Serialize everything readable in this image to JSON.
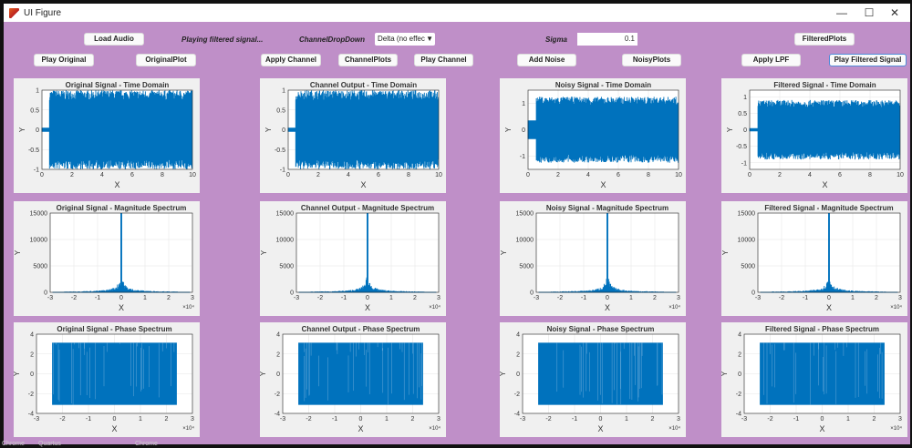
{
  "window": {
    "title": "UI Figure",
    "minimize": "—",
    "maximize": "☐",
    "close": "✕"
  },
  "controls": {
    "load_audio": "Load Audio",
    "status": "Playing filtered signal...",
    "channel_label": "ChannelDropDown",
    "channel_value": "Delta (no effec",
    "sigma_label": "Sigma",
    "sigma_value": "0.1",
    "filtered_plots": "FilteredPlots",
    "play_original": "Play Original",
    "original_plot": "OriginalPlot",
    "apply_channel": "Apply Channel",
    "channel_plots": "ChannelPlots",
    "play_channel": "Play Channel",
    "add_noise": "Add Noise",
    "noisy_plots": "NoisyPlots",
    "apply_lpf": "Apply LPF",
    "play_filtered": "Play Filtered Signal"
  },
  "taskbar": [
    "Chrome",
    "Quartus",
    "Chrome"
  ],
  "colors": {
    "background": "#bf8fc8",
    "trace": "#0072bd"
  },
  "chart_data": [
    {
      "id": "orig-time",
      "type": "line",
      "title": "Original Signal - Time Domain",
      "xlabel": "X",
      "ylabel": "Y",
      "xlim": [
        0,
        10
      ],
      "ylim": [
        -1,
        1
      ],
      "xticks": [
        "0",
        "2",
        "4",
        "6",
        "8",
        "10"
      ],
      "yticks": [
        "-1",
        "-0.5",
        "0",
        "0.5",
        "1"
      ],
      "kind": "time",
      "onset": 0.5,
      "amp": 1,
      "pre": 0.05
    },
    {
      "id": "chan-time",
      "type": "line",
      "title": "Channel Output - Time Domain",
      "xlabel": "X",
      "ylabel": "Y",
      "xlim": [
        0,
        10
      ],
      "ylim": [
        -1,
        1
      ],
      "xticks": [
        "0",
        "2",
        "4",
        "6",
        "8",
        "10"
      ],
      "yticks": [
        "-1",
        "-0.5",
        "0",
        "0.5",
        "1"
      ],
      "kind": "time",
      "onset": 0.5,
      "amp": 1,
      "pre": 0.05
    },
    {
      "id": "noisy-time",
      "type": "line",
      "title": "Noisy Signal - Time Domain",
      "xlabel": "X",
      "ylabel": "Y",
      "xlim": [
        0,
        10
      ],
      "ylim": [
        -1.5,
        1.5
      ],
      "xticks": [
        "0",
        "2",
        "4",
        "6",
        "8",
        "10"
      ],
      "yticks": [
        "-1",
        "0",
        "1"
      ],
      "kind": "time",
      "onset": 0.55,
      "amp": 1.25,
      "pre": 0.35
    },
    {
      "id": "filt-time",
      "type": "line",
      "title": "Filtered Signal - Time Domain",
      "xlabel": "X",
      "ylabel": "Y",
      "xlim": [
        0,
        10
      ],
      "ylim": [
        -1.2,
        1.2
      ],
      "xticks": [
        "0",
        "2",
        "4",
        "6",
        "8",
        "10"
      ],
      "yticks": [
        "-1",
        "-0.5",
        "0",
        "0.5",
        "1"
      ],
      "kind": "time",
      "onset": 0.55,
      "amp": 0.9,
      "pre": 0.05
    },
    {
      "id": "orig-mag",
      "type": "line",
      "title": "Original Signal - Magnitude Spectrum",
      "xlabel": "X",
      "ylabel": "Y",
      "xlim": [
        -3,
        3
      ],
      "ylim": [
        0,
        15000
      ],
      "xticks": [
        "-3",
        "-2",
        "-1",
        "0",
        "1",
        "2",
        "3"
      ],
      "yticks": [
        "0",
        "5000",
        "10000",
        "15000"
      ],
      "exponent": "×10⁴",
      "kind": "mag",
      "peak": 15000,
      "band": 2.4
    },
    {
      "id": "chan-mag",
      "type": "line",
      "title": "Channel Output - Magnitude Spectrum",
      "xlabel": "X",
      "ylabel": "Y",
      "xlim": [
        -3,
        3
      ],
      "ylim": [
        0,
        15000
      ],
      "xticks": [
        "-3",
        "-2",
        "-1",
        "0",
        "1",
        "2",
        "3"
      ],
      "yticks": [
        "0",
        "5000",
        "10000",
        "15000"
      ],
      "exponent": "×10⁴",
      "kind": "mag",
      "peak": 15000,
      "band": 2.4
    },
    {
      "id": "noisy-mag",
      "type": "line",
      "title": "Noisy Signal - Magnitude Spectrum",
      "xlabel": "X",
      "ylabel": "Y",
      "xlim": [
        -3,
        3
      ],
      "ylim": [
        0,
        15000
      ],
      "xticks": [
        "-3",
        "-2",
        "-1",
        "0",
        "1",
        "2",
        "3"
      ],
      "yticks": [
        "0",
        "5000",
        "10000",
        "15000"
      ],
      "exponent": "×10⁴",
      "kind": "mag",
      "peak": 15000,
      "band": 2.4
    },
    {
      "id": "filt-mag",
      "type": "line",
      "title": "Filtered Signal - Magnitude Spectrum",
      "xlabel": "X",
      "ylabel": "Y",
      "xlim": [
        -3,
        3
      ],
      "ylim": [
        0,
        15000
      ],
      "xticks": [
        "-3",
        "-2",
        "-1",
        "0",
        "1",
        "2",
        "3"
      ],
      "yticks": [
        "0",
        "5000",
        "10000",
        "15000"
      ],
      "exponent": "×10⁴",
      "kind": "mag",
      "peak": 15000,
      "band": 2.4
    },
    {
      "id": "orig-phase",
      "type": "line",
      "title": "Original Signal - Phase Spectrum",
      "xlabel": "X",
      "ylabel": "Y",
      "xlim": [
        -3,
        3
      ],
      "ylim": [
        -4,
        4
      ],
      "xticks": [
        "-3",
        "-2",
        "-1",
        "0",
        "1",
        "2",
        "3"
      ],
      "yticks": [
        "-4",
        "-2",
        "0",
        "2",
        "4"
      ],
      "exponent": "×10⁴",
      "kind": "phase",
      "band": 2.4
    },
    {
      "id": "chan-phase",
      "type": "line",
      "title": "Channel Output - Phase Spectrum",
      "xlabel": "X",
      "ylabel": "Y",
      "xlim": [
        -3,
        3
      ],
      "ylim": [
        -4,
        4
      ],
      "xticks": [
        "-3",
        "-2",
        "-1",
        "0",
        "1",
        "2",
        "3"
      ],
      "yticks": [
        "-4",
        "-2",
        "0",
        "2",
        "4"
      ],
      "exponent": "×10⁴",
      "kind": "phase",
      "band": 2.4
    },
    {
      "id": "noisy-phase",
      "type": "line",
      "title": "Noisy Signal - Phase Spectrum",
      "xlabel": "X",
      "ylabel": "Y",
      "xlim": [
        -3,
        3
      ],
      "ylim": [
        -4,
        4
      ],
      "xticks": [
        "-3",
        "-2",
        "-1",
        "0",
        "1",
        "2",
        "3"
      ],
      "yticks": [
        "-4",
        "-2",
        "0",
        "2",
        "4"
      ],
      "exponent": "×10⁴",
      "kind": "phase",
      "band": 2.4
    },
    {
      "id": "filt-phase",
      "type": "line",
      "title": "Filtered Signal - Phase Spectrum",
      "xlabel": "X",
      "ylabel": "Y",
      "xlim": [
        -3,
        3
      ],
      "ylim": [
        -4,
        4
      ],
      "xticks": [
        "-3",
        "-2",
        "-1",
        "0",
        "1",
        "2",
        "3"
      ],
      "yticks": [
        "-4",
        "-2",
        "0",
        "2",
        "4"
      ],
      "exponent": "×10⁴",
      "kind": "phase",
      "band": 2.4
    }
  ]
}
